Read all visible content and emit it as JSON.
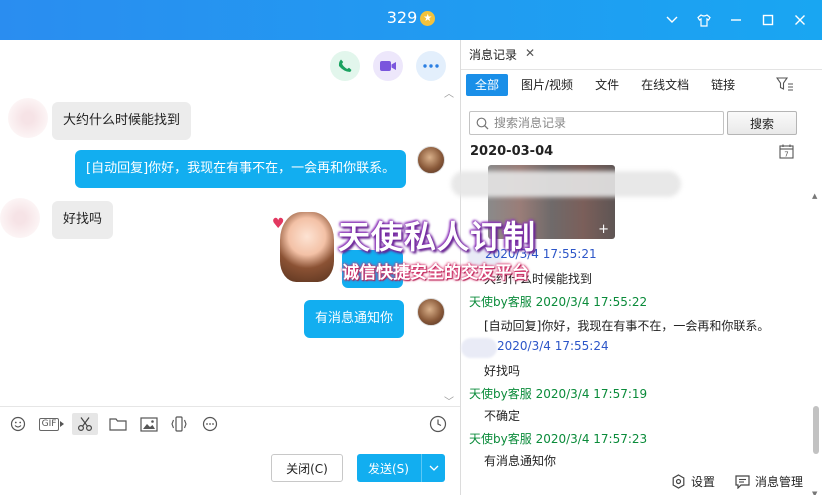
{
  "window": {
    "title": "329",
    "star_glyph": "★",
    "controls": [
      "chevron-down-icon",
      "tshirt-skin-icon",
      "minimize-icon",
      "maximize-icon",
      "close-icon"
    ]
  },
  "chat": {
    "actions": [
      "phone-icon",
      "video-icon",
      "more-icon"
    ],
    "messages": [
      {
        "dir": "in",
        "text": "大约什么时候能找到"
      },
      {
        "dir": "out",
        "text": "[自动回复]你好，我现在有事不在，一会再和你联系。"
      },
      {
        "dir": "in",
        "text": "好找吗"
      },
      {
        "dir": "out",
        "text": "不确定"
      },
      {
        "dir": "out",
        "text": "有消息通知你"
      }
    ],
    "promo": {
      "title": "天使私人订制",
      "subtitle": "诚信快捷安全的交友平台"
    },
    "toolbar": [
      "emoji-icon",
      "gif-icon",
      "scissors-icon",
      "folder-icon",
      "image-icon",
      "shake-icon",
      "more-icon",
      "clock-icon"
    ],
    "gif_label": "GIF",
    "close_button": "关闭(C)",
    "send_button": "发送(S)"
  },
  "history": {
    "tab_label": "消息记录",
    "filters": [
      "全部",
      "图片/视频",
      "文件",
      "在线文档",
      "链接"
    ],
    "active_filter": "全部",
    "search_placeholder": "搜索消息记录",
    "search_button": "搜索",
    "date": "2020-03-04",
    "records": [
      {
        "sender": "",
        "sender_type": "peer",
        "time": "2020/3/4 17:55:21",
        "text": "大约什么时候能找到"
      },
      {
        "sender": "天使by客服",
        "sender_type": "service",
        "time": "2020/3/4 17:55:22",
        "text": "[自动回复]你好，我现在有事不在，一会再和你联系。"
      },
      {
        "sender": "",
        "sender_type": "peer",
        "time": "2020/3/4 17:55:24",
        "text": "好找吗"
      },
      {
        "sender": "天使by客服",
        "sender_type": "service",
        "time": "2020/3/4 17:57:19",
        "text": "不确定"
      },
      {
        "sender": "天使by客服",
        "sender_type": "service",
        "time": "2020/3/4 17:57:23",
        "text": "有消息通知你"
      }
    ],
    "footer": {
      "settings": "设置",
      "manage": "消息管理"
    }
  },
  "colors": {
    "titlebar": "#2a8df0",
    "bubble_out": "#12aef0",
    "bubble_in": "#ececec",
    "service_name": "#0a8b3a",
    "peer_name": "#2d56c8",
    "active_filter": "#1a8fe8"
  }
}
